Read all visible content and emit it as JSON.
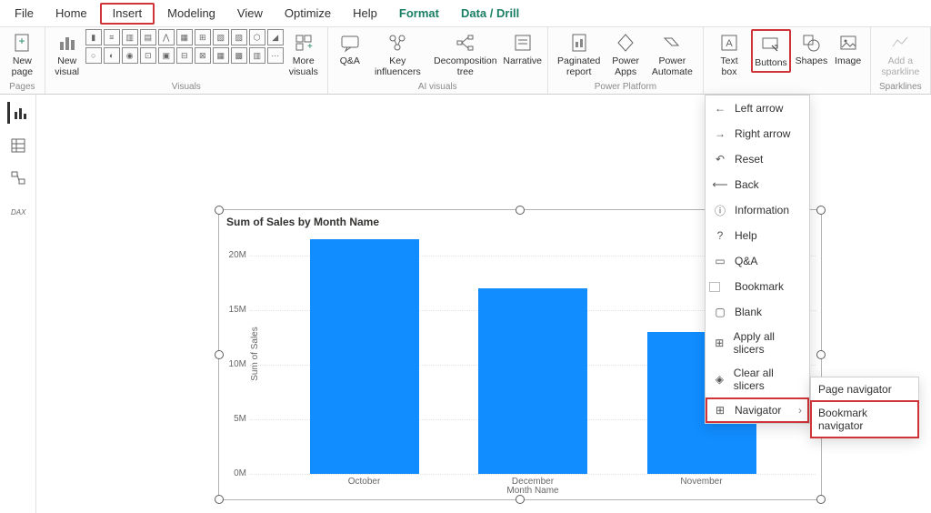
{
  "tabs": [
    "File",
    "Home",
    "Insert",
    "Modeling",
    "View",
    "Optimize",
    "Help",
    "Format",
    "Data / Drill"
  ],
  "ribbon": {
    "pages": {
      "new_page": "New\npage",
      "label": "Pages"
    },
    "visuals": {
      "new_visual": "New\nvisual",
      "more": "More\nvisuals",
      "label": "Visuals"
    },
    "ai": {
      "qa": "Q&A",
      "ki": "Key\ninfluencers",
      "dt": "Decomposition\ntree",
      "nar": "Narrative",
      "label": "AI visuals"
    },
    "pp": {
      "pag": "Paginated\nreport",
      "pa": "Power\nApps",
      "paut": "Power\nAutomate",
      "label": "Power Platform"
    },
    "elements": {
      "tb": "Text\nbox",
      "btn": "Buttons",
      "sh": "Shapes",
      "img": "Image"
    },
    "spark": {
      "add": "Add a\nsparkline",
      "label": "Sparklines"
    }
  },
  "menu_items": [
    {
      "icon": "←",
      "label": "Left arrow"
    },
    {
      "icon": "→",
      "label": "Right arrow"
    },
    {
      "icon": "↶",
      "label": "Reset"
    },
    {
      "icon": "⟵",
      "label": "Back"
    },
    {
      "icon": "ⓘ",
      "label": "Information"
    },
    {
      "icon": "?",
      "label": "Help"
    },
    {
      "icon": "▭",
      "label": "Q&A"
    },
    {
      "icon": "⃞",
      "label": "Bookmark"
    },
    {
      "icon": "▢",
      "label": "Blank"
    },
    {
      "icon": "⊞",
      "label": "Apply all slicers"
    },
    {
      "icon": "◈",
      "label": "Clear all slicers"
    },
    {
      "icon": "⊞",
      "label": "Navigator"
    }
  ],
  "submenu": [
    "Page navigator",
    "Bookmark navigator"
  ],
  "chart_data": {
    "type": "bar",
    "title": "Sum of Sales by Month Name",
    "xlabel": "Month Name",
    "ylabel": "Sum of Sales",
    "categories": [
      "October",
      "December",
      "November"
    ],
    "values": [
      21500000,
      17000000,
      13000000
    ],
    "yticks": [
      0,
      5000000,
      10000000,
      15000000,
      20000000
    ],
    "ytick_labels": [
      "0M",
      "5M",
      "10M",
      "15M",
      "20M"
    ],
    "ylim": [
      0,
      22000000
    ]
  }
}
